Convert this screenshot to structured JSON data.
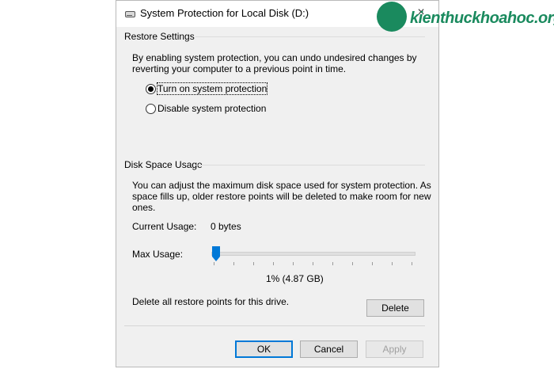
{
  "dialog": {
    "title": "System Protection for Local Disk (D:)",
    "close_glyph": "×"
  },
  "restore_settings": {
    "heading": "Restore Settings",
    "description_line1": "By enabling system protection, you can undo undesired changes by",
    "description_line2": "reverting your computer to a previous point in time.",
    "options": [
      {
        "label": "Turn on system protection",
        "selected": true
      },
      {
        "label": "Disable system protection",
        "selected": false
      }
    ]
  },
  "disk_space": {
    "heading": "Disk Space Usage",
    "description_line1": "You can adjust the maximum disk space used for system protection. As",
    "description_line2": "space fills up, older restore points will be deleted to make room for new",
    "description_line3": "ones.",
    "current_usage_label": "Current Usage:",
    "current_usage_value": "0 bytes",
    "max_usage_label": "Max Usage:",
    "max_usage_percent": 1,
    "max_usage_readout": "1% (4.87 GB)",
    "delete_text": "Delete all restore points for this drive.",
    "delete_button": "Delete"
  },
  "footer": {
    "ok": "OK",
    "cancel": "Cancel",
    "apply": "Apply"
  },
  "watermark": {
    "text": "kienthuckhoahoc.org"
  },
  "colors": {
    "accent": "#0078d7",
    "dialog_bg": "#f0f0f0",
    "watermark_green": "#1a8a5e"
  }
}
